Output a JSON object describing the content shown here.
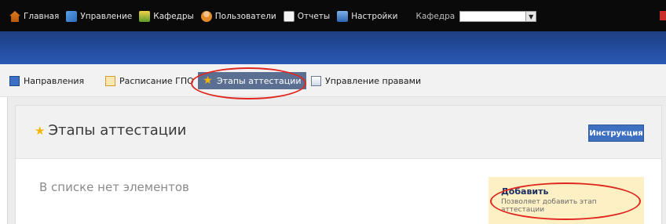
{
  "topbar": {
    "menu": [
      {
        "label": "Главная",
        "icon": "home-icon"
      },
      {
        "label": "Управление",
        "icon": "manage-icon"
      },
      {
        "label": "Кафедры",
        "icon": "departments-icon"
      },
      {
        "label": "Пользователи",
        "icon": "users-icon"
      },
      {
        "label": "Отчеты",
        "icon": "reports-icon"
      },
      {
        "label": "Настройки",
        "icon": "settings-icon"
      }
    ],
    "kafedra_label": "Кафедра",
    "kafedra_value": ""
  },
  "subnav": {
    "tabs": [
      {
        "label": "Направления",
        "icon": "directions-icon"
      },
      {
        "label": "Расписание ГПО",
        "icon": "schedule-icon"
      },
      {
        "label": "Этапы аттестации",
        "icon": "star-icon",
        "active": true
      },
      {
        "label": "Управление правами",
        "icon": "rights-icon"
      }
    ]
  },
  "panel": {
    "title": "Этапы аттестации",
    "instruction_button": "Инструкция",
    "empty_text": "В списке нет элементов",
    "add": {
      "title": "Добавить",
      "description": "Позволяет добавить этап аттестации"
    }
  },
  "colors": {
    "topbar_bg": "#0a0a0a",
    "band_blue": "#2a59b6",
    "active_tab": "#5b6f93",
    "button_blue": "#3e6fc0",
    "annotation_red": "#e0271f",
    "add_box_bg": "#fdf0c4"
  }
}
